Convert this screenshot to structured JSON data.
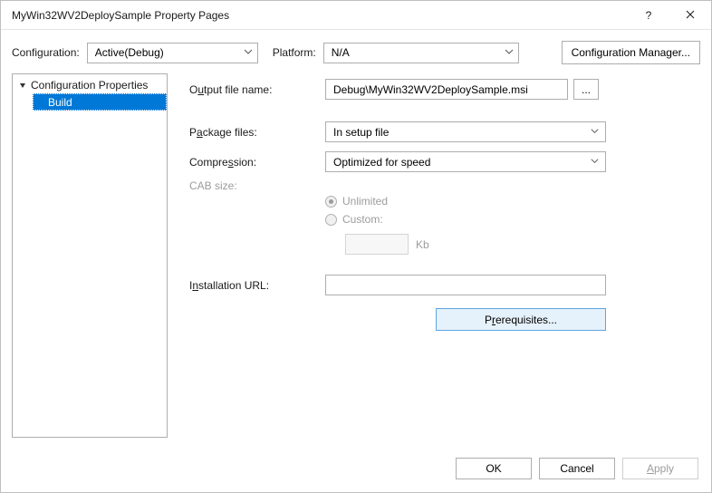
{
  "window": {
    "title": "MyWin32WV2DeploySample Property Pages",
    "help": "?"
  },
  "toolbar": {
    "configuration_label": "Configuration:",
    "configuration_value": "Active(Debug)",
    "platform_label": "Platform:",
    "platform_value": "N/A",
    "cfg_manager": "Configuration Manager..."
  },
  "tree": {
    "root": "Configuration Properties",
    "items": [
      "Build"
    ]
  },
  "form": {
    "output_label_pre": "O",
    "output_label_mid": "u",
    "output_label_post": "tput file name:",
    "output_value": "Debug\\MyWin32WV2DeploySample.msi",
    "browse_dots": "...",
    "package_label_pre": "P",
    "package_label_mid": "a",
    "package_label_post": "ckage files:",
    "package_value": "In setup file",
    "compression_label_pre": "Compre",
    "compression_label_mid": "s",
    "compression_label_post": "sion:",
    "compression_value": "Optimized for speed",
    "cab_label": "CAB size:",
    "cab_unlimited_pre": "U",
    "cab_unlimited_post": "nlimited",
    "cab_custom_pre": "C",
    "cab_custom_post": "ustom:",
    "kb_label_pre": "K",
    "kb_label_post": "b",
    "url_label_pre": "I",
    "url_label_mid": "n",
    "url_label_post": "stallation URL:",
    "url_value": "",
    "prereq_pre": "P",
    "prereq_mid": "r",
    "prereq_post": "erequisites..."
  },
  "footer": {
    "ok": "OK",
    "cancel": "Cancel",
    "apply_pre": "A",
    "apply_post": "pply"
  }
}
